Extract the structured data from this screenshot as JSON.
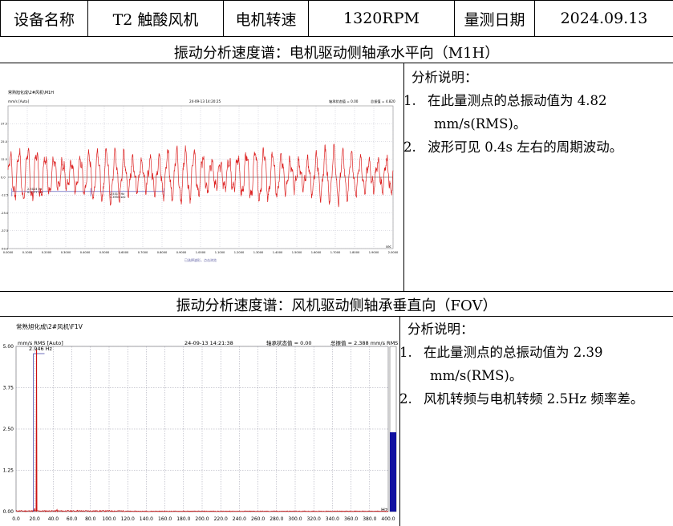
{
  "header": {
    "device_label": "设备名称",
    "device_value": "T2 触酸风机",
    "motor_speed_label": "电机转速",
    "motor_speed_value": "1320RPM",
    "date_label": "量测日期",
    "date_value": "2024.09.13"
  },
  "section1": {
    "title": "振动分析速度谱：电机驱动侧轴承水平向（M1H）",
    "notes_title": "分析说明：",
    "notes": [
      {
        "num": "1.",
        "text": "在此量测点的总振动值为 4.82",
        "cont": "mm/s(RMS)。"
      },
      {
        "num": "2.",
        "text": "波形可见 0.4s 左右的周期波动。"
      }
    ],
    "chart_data": {
      "type": "line",
      "header_left": "常熟旭化成\\2#风机\\M1H",
      "ylabel": "mm/s [Auto]",
      "timestamp": "24-09-13 14:20:25",
      "status": "轴承状态值 = 0.00",
      "overall": "总振值 = 4.820",
      "xlabel": "sec",
      "footer": "已选择波形，点击浏览",
      "xlim": [
        0,
        2.0
      ],
      "ylim": [
        -50,
        50
      ],
      "y_ticks": [
        "37.5",
        "25.0",
        "12.5",
        "0.0",
        "-12.5",
        "-25.0",
        "-37.5",
        "-50.0"
      ],
      "x_ticks": [
        "0.0000",
        "0.1000",
        "0.2000",
        "0.3000",
        "0.4000",
        "0.5000",
        "0.6000",
        "0.7000",
        "0.8000",
        "0.9000",
        "1.0000",
        "1.1000",
        "1.2000",
        "1.3000",
        "1.4000",
        "1.5000",
        "1.6000",
        "1.7000",
        "1.8000",
        "1.9000",
        "2.0000"
      ],
      "cursor1": {
        "label": "2.5024 Hz",
        "sublabel": "0.4177 sec",
        "x_start": 0.02,
        "x_end": 0.43
      },
      "cursor2": {
        "label": "2.5317 Hz",
        "sublabel": "0.3950 sec",
        "x_start": 0.43,
        "x_end": 0.81
      },
      "waveform": {
        "rms": 4.82,
        "peak_amplitude": 17,
        "carrier_hz": 22,
        "modulation_hz": 2.5
      },
      "color": "#dd2222"
    }
  },
  "section2": {
    "title": "振动分析速度谱：风机驱动侧轴承垂直向（FOV）",
    "notes_title": "分析说明：",
    "notes": [
      {
        "num": "1.",
        "text": "在此量测点的总振动值为 2.39",
        "cont": "mm/s(RMS)。"
      },
      {
        "num": "2.",
        "text": "风机转频与电机转频 2.5Hz 频率差。"
      }
    ],
    "chart_data": {
      "type": "line",
      "header_left": "常熟旭化成\\2#风机\\F1V",
      "ylabel": "mm/s RMS [Auto]",
      "timestamp": "24-09-13 14:21:38",
      "status": "轴承状态值 = 0.00",
      "overall": "总振值 = 2.388 mm/s RMS",
      "xlabel": "Hz",
      "peak_label": "2.946 Hz",
      "xlim": [
        0,
        400
      ],
      "ylim": [
        0,
        5.0
      ],
      "y_ticks": [
        "5.00",
        "3.75",
        "2.50",
        "1.25",
        "0.00"
      ],
      "x_ticks": [
        "0.0",
        "20.0",
        "40.0",
        "60.0",
        "80.0",
        "100.0",
        "120.0",
        "140.0",
        "160.0",
        "180.0",
        "200.0",
        "220.0",
        "240.0",
        "260.0",
        "280.0",
        "300.0",
        "320.0",
        "340.0",
        "360.0",
        "380.0",
        "400.0"
      ],
      "peaks": [
        {
          "x": 22,
          "y": 4.9
        },
        {
          "x": 20,
          "y": 0.1
        },
        {
          "x": 44,
          "y": 0.06
        },
        {
          "x": 66,
          "y": 0.04
        },
        {
          "x": 100,
          "y": 0.03
        },
        {
          "x": 150,
          "y": 0.02
        },
        {
          "x": 230,
          "y": 0.02
        }
      ],
      "overall_bar_fraction": 0.48,
      "color": "#cc1111",
      "bar_color": "#1010a0"
    }
  }
}
